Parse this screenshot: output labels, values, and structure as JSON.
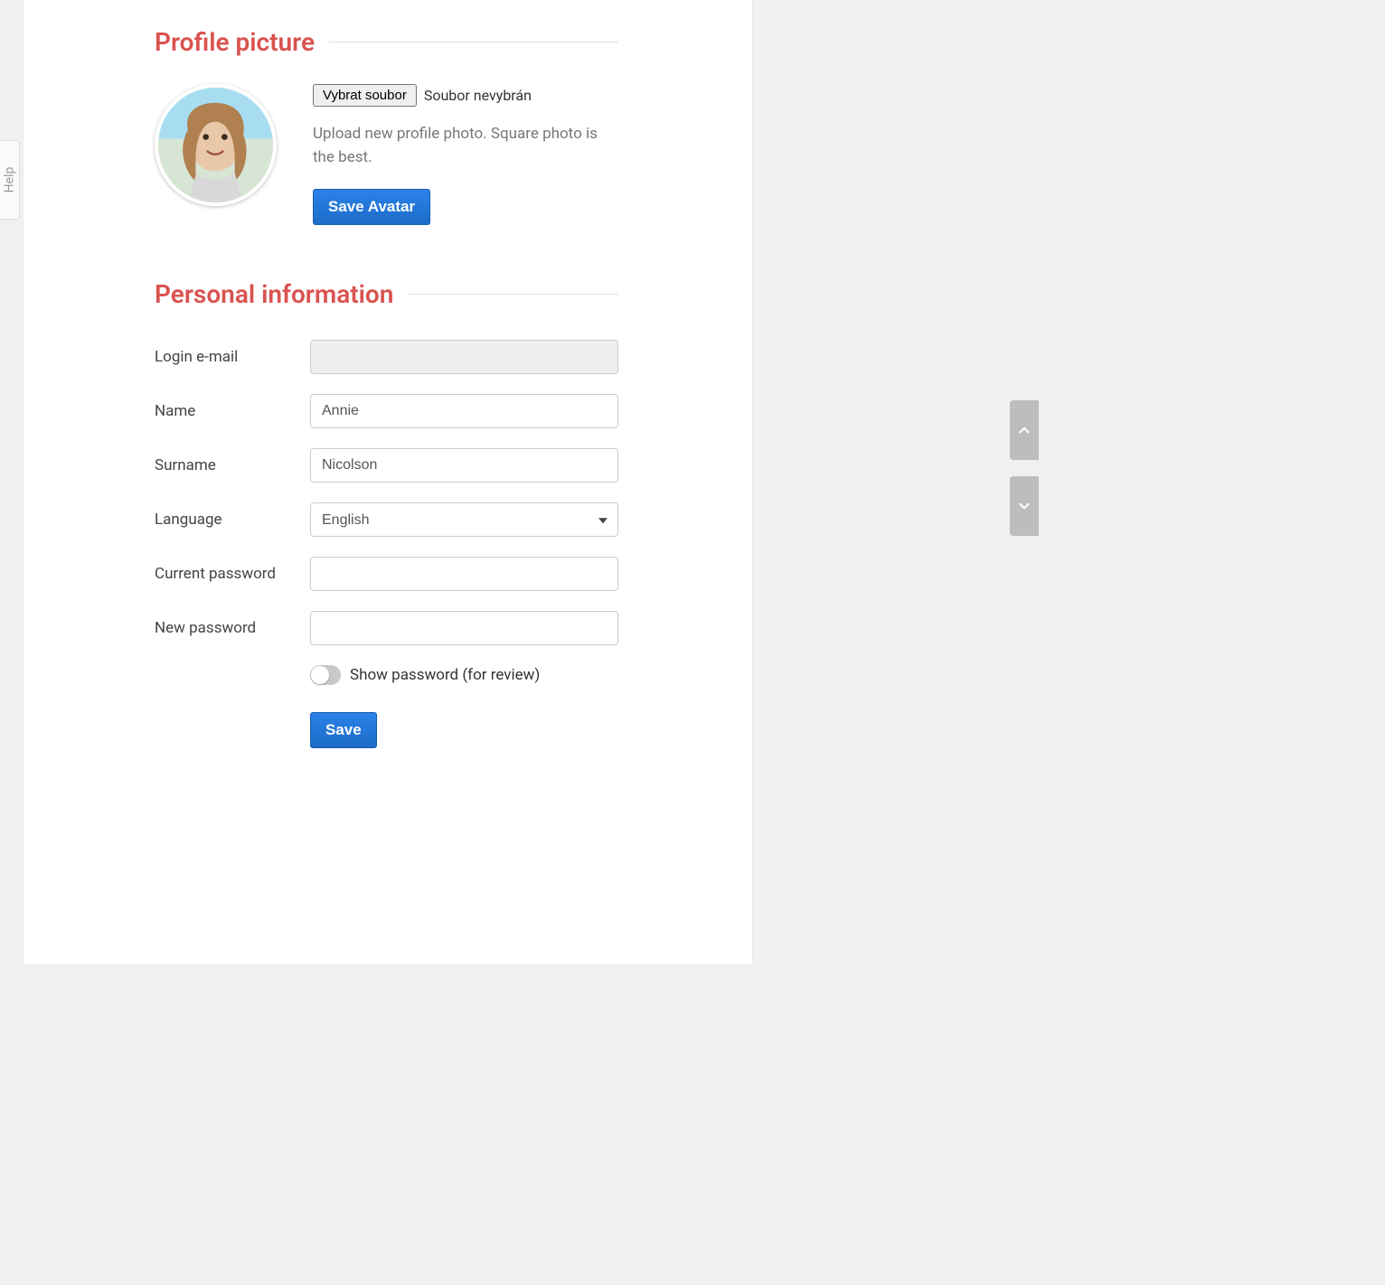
{
  "help_tab": "Help",
  "profile_picture": {
    "title": "Profile picture",
    "file_button": "Vybrat soubor",
    "file_status": "Soubor nevybrán",
    "hint": "Upload new profile photo. Square photo is the best.",
    "save_button": "Save Avatar"
  },
  "personal_info": {
    "title": "Personal information",
    "login_email_label": "Login e-mail",
    "login_email_value": "",
    "name_label": "Name",
    "name_value": "Annie",
    "surname_label": "Surname",
    "surname_value": "Nicolson",
    "language_label": "Language",
    "language_value": "English",
    "current_password_label": "Current password",
    "current_password_value": "",
    "new_password_label": "New password",
    "new_password_value": "",
    "show_password_label": "Show password (for review)",
    "save_button": "Save"
  }
}
